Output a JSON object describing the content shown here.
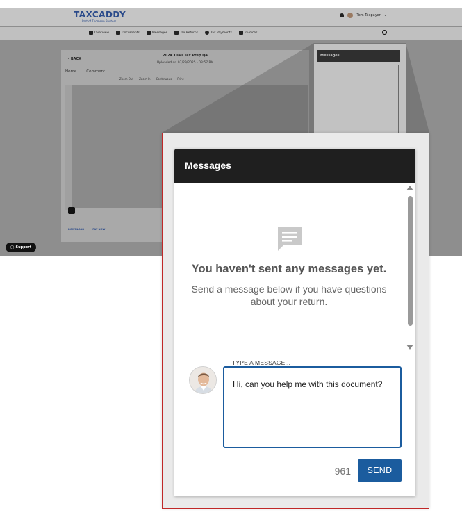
{
  "app": {
    "brand": "TAXCADDY",
    "brand_sub": "Part of Thomson Reuters",
    "user_name": "Tom Taxpayer",
    "nav": [
      "Overview",
      "Documents",
      "Messages",
      "Tax Returns",
      "Tax Payments",
      "Invoices"
    ]
  },
  "document": {
    "back_label": "BACK",
    "title": "2024 1040 Tax Prep Q4",
    "uploaded": "Uploaded on 07/29/2025 - 03:57 PM",
    "tabs": [
      "Home",
      "Comment"
    ],
    "toolbar": [
      "Zoom Out",
      "Zoom In",
      "Continuous",
      "Print"
    ],
    "actions": [
      "DOWNLOAD",
      "PAY NOW"
    ]
  },
  "support_label": "Support",
  "mini_messages_title": "Messages",
  "messages": {
    "title": "Messages",
    "empty_title": "You haven't sent any messages yet.",
    "empty_subtitle": "Send a message below if you have questions about your return.",
    "input_label": "TYPE A MESSAGE...",
    "input_value": "Hi, can you help me with this document?",
    "char_count": "961",
    "send_label": "SEND"
  },
  "colors": {
    "accent": "#1b5c9e",
    "header_dark": "#1f1f1f",
    "highlight_border": "#c02828"
  }
}
